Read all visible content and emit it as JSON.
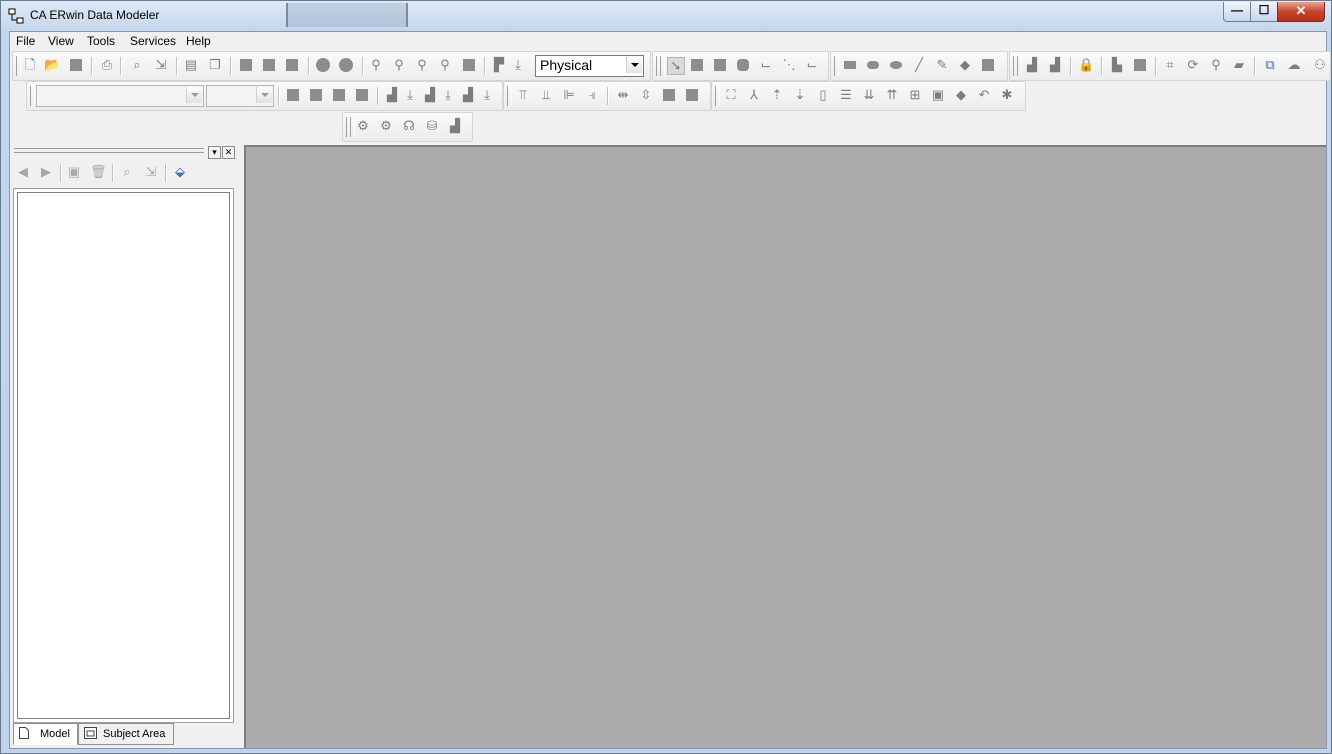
{
  "window": {
    "title": "CA ERwin Data Modeler",
    "min_glyph": "—",
    "max_glyph": "☐",
    "close_glyph": "✕"
  },
  "menu": {
    "items": [
      "File",
      "View",
      "Tools",
      "Services",
      "Help"
    ]
  },
  "toolbar": {
    "model_type": "Physical"
  },
  "left_pane": {
    "close_glyph": "✕",
    "dropdown_glyph": "▾",
    "tabs": [
      {
        "label": "Model"
      },
      {
        "label": "Subject Area"
      }
    ]
  },
  "colors": {
    "workspace": "#ababab",
    "chrome": "#f0f0f0",
    "titlebar": "#c4d6ec",
    "close": "#c7452c"
  }
}
